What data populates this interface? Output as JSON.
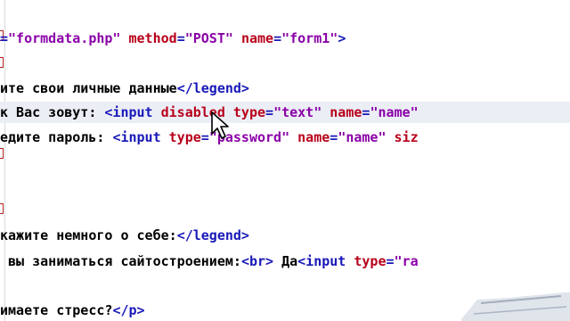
{
  "lines": [
    {
      "id": "line-form",
      "parts": [
        {
          "t": "tag",
          "s": "="
        },
        {
          "t": "val",
          "s": "\"formdata.php\""
        },
        {
          "t": "txt",
          "s": " "
        },
        {
          "t": "attr",
          "s": "method"
        },
        {
          "t": "tag",
          "s": "="
        },
        {
          "t": "val",
          "s": "\"POST\""
        },
        {
          "t": "txt",
          "s": " "
        },
        {
          "t": "attr",
          "s": "name"
        },
        {
          "t": "tag",
          "s": "="
        },
        {
          "t": "val",
          "s": "\"form1\""
        },
        {
          "t": "tag",
          "s": ">"
        }
      ]
    },
    {
      "id": "line-legend-1",
      "parts": [
        {
          "t": "txt",
          "s": "ите свои личные данные"
        },
        {
          "t": "tag",
          "s": "</legend>"
        }
      ]
    },
    {
      "id": "line-name-input",
      "parts": [
        {
          "t": "txt",
          "s": "к Вас зовут: "
        },
        {
          "t": "tag",
          "s": "<input"
        },
        {
          "t": "txt",
          "s": " "
        },
        {
          "t": "attr",
          "s": "disabled"
        },
        {
          "t": "txt",
          "s": " "
        },
        {
          "t": "attr",
          "s": "type"
        },
        {
          "t": "tag",
          "s": "="
        },
        {
          "t": "val",
          "s": "\"text\""
        },
        {
          "t": "txt",
          "s": " "
        },
        {
          "t": "attr",
          "s": "name"
        },
        {
          "t": "tag",
          "s": "="
        },
        {
          "t": "val",
          "s": "\"name\""
        }
      ]
    },
    {
      "id": "line-password-input",
      "parts": [
        {
          "t": "txt",
          "s": "едите пароль: "
        },
        {
          "t": "tag",
          "s": "<input"
        },
        {
          "t": "txt",
          "s": " "
        },
        {
          "t": "attr",
          "s": "type"
        },
        {
          "t": "tag",
          "s": "="
        },
        {
          "t": "val",
          "s": "\"password\""
        },
        {
          "t": "txt",
          "s": " "
        },
        {
          "t": "attr",
          "s": "name"
        },
        {
          "t": "tag",
          "s": "="
        },
        {
          "t": "val",
          "s": "\"name\""
        },
        {
          "t": "txt",
          "s": " "
        },
        {
          "t": "attr",
          "s": "siz"
        }
      ]
    },
    {
      "id": "line-legend-2",
      "parts": [
        {
          "t": "txt",
          "s": "кажите немного о себе:"
        },
        {
          "t": "tag",
          "s": "</legend>"
        }
      ]
    },
    {
      "id": "line-radio",
      "parts": [
        {
          "t": "txt",
          "s": " вы заниматься сайтостроением:"
        },
        {
          "t": "tag",
          "s": "<br>"
        },
        {
          "t": "txt",
          "s": " Да"
        },
        {
          "t": "tag",
          "s": "<input"
        },
        {
          "t": "txt",
          "s": " "
        },
        {
          "t": "attr",
          "s": "type"
        },
        {
          "t": "tag",
          "s": "="
        },
        {
          "t": "val",
          "s": "\"ra"
        }
      ]
    },
    {
      "id": "line-stress",
      "parts": [
        {
          "t": "txt",
          "s": "имаете стресс?"
        },
        {
          "t": "tag",
          "s": "</p>"
        }
      ]
    }
  ],
  "colors": {
    "tag": "#1818b8",
    "attr": "#b8001a",
    "value": "#8a00a8",
    "text": "#000000",
    "highlight_row": "#eceef6"
  },
  "icons": {
    "cursor": "mouse-pointer-icon"
  }
}
